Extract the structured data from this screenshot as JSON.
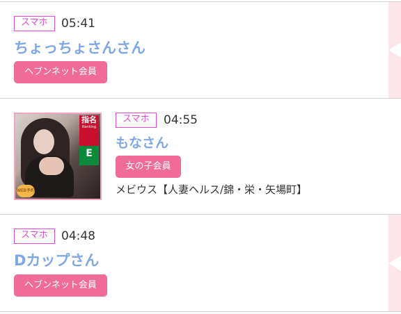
{
  "entries": [
    {
      "device_badge": "スマホ",
      "time": "05:41",
      "name": "ちょっちょさんさん",
      "member_type": "ヘブンネット会員"
    },
    {
      "device_badge": "スマホ",
      "time": "04:55",
      "name": "もなさん",
      "member_type": "女の子会員",
      "shop": "メビウス【人妻ヘルス/錦・栄・矢場町】",
      "photo": {
        "tag_label": "指名",
        "tag_sub": "Ranking",
        "rank": "E",
        "web_label": "WEB予約"
      }
    },
    {
      "device_badge": "スマホ",
      "time": "04:48",
      "name": "Dカップさん",
      "member_type": "ヘブンネット会員"
    }
  ],
  "colors": {
    "badge": "#e14bd6",
    "name": "#7fa7e6",
    "pill": "#f06b97",
    "side_panel": "#fde6ea"
  }
}
